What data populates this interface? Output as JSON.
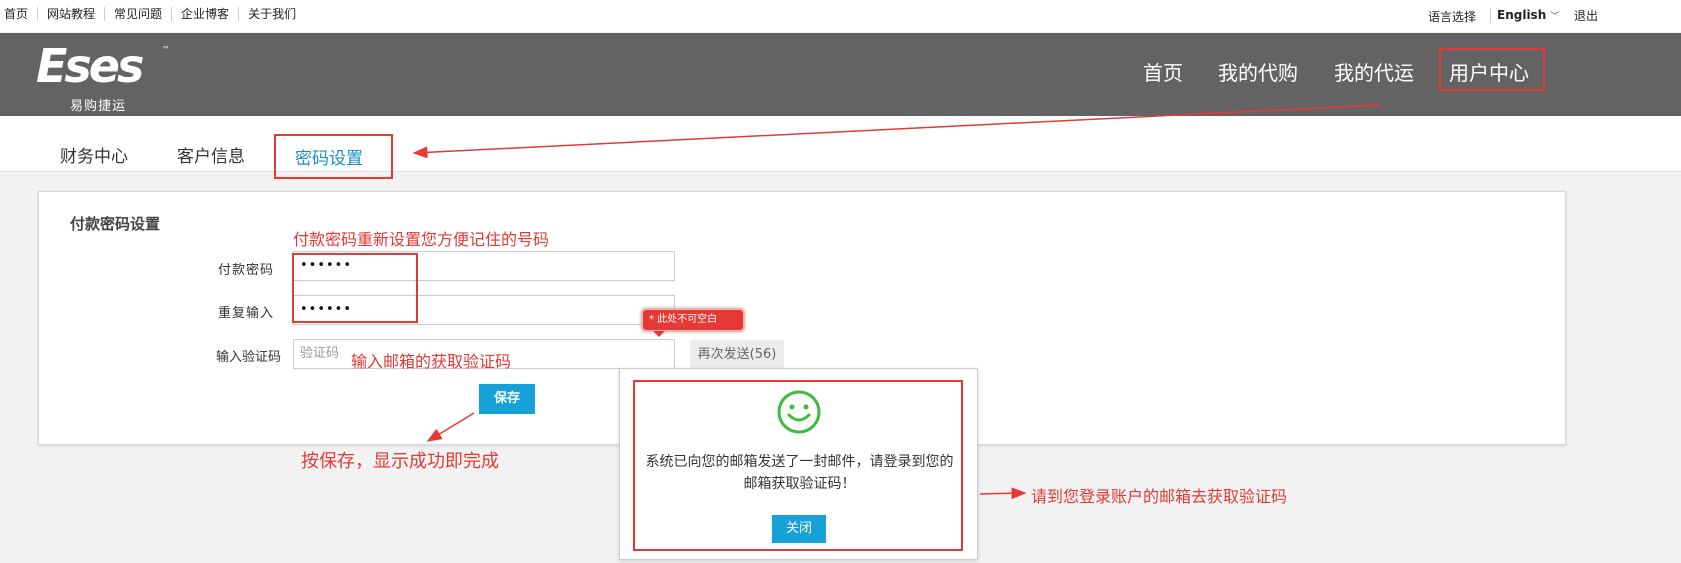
{
  "top_links": [
    "首页",
    "网站教程",
    "常见问题",
    "企业博客",
    "关于我们"
  ],
  "language": {
    "label": "语言选择",
    "selected": "English",
    "logout": "退出"
  },
  "logo": {
    "main": "Eses",
    "tm": "™",
    "sub": "易购捷运"
  },
  "main_nav": [
    "首页",
    "我的代购",
    "我的代运",
    "用户中心"
  ],
  "tabs": [
    "财务中心",
    "客户信息",
    "密码设置"
  ],
  "form": {
    "title": "付款密码设置",
    "hint_top": "付款密码重新设置您方便记住的号码",
    "password_label": "付款密码",
    "password_value": "••••••",
    "repeat_label": "重复输入",
    "repeat_value": "••••••",
    "code_label": "输入验证码",
    "code_placeholder": "验证码",
    "code_hint": "输入邮箱的获取验证码",
    "tooltip": "* 此处不可空白",
    "resend": "再次发送(56)",
    "save": "保存",
    "save_hint": "按保存，显示成功即完成"
  },
  "modal": {
    "message": "系统已向您的邮箱发送了一封邮件，请登录到您的邮箱获取验证码！",
    "close": "关闭",
    "side_hint": "请到您登录账户的邮箱去获取验证码"
  },
  "colors": {
    "annotation": "#e53935",
    "accent": "#16a1d8",
    "header": "#636363"
  }
}
